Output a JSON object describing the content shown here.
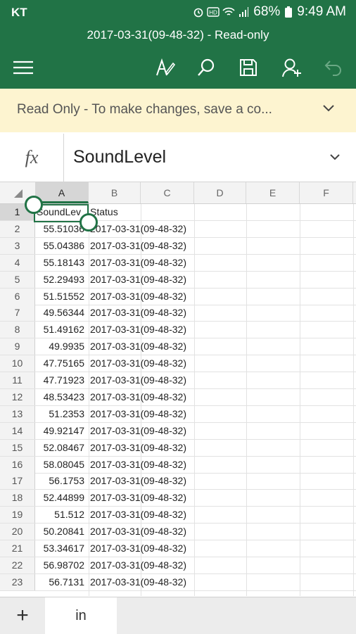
{
  "statusbar": {
    "carrier": "KT",
    "battery": "68%",
    "time": "9:49 AM"
  },
  "appbar": {
    "title": "2017-03-31(09-48-32) - Read-only",
    "icons": [
      "menu-icon",
      "draw-icon",
      "search-icon",
      "save-icon",
      "share-icon",
      "undo-icon"
    ]
  },
  "banner": {
    "message": "Read Only - To make changes, save a co..."
  },
  "formula": {
    "fx": "fx",
    "content": "SoundLevel"
  },
  "columns": [
    "A",
    "B",
    "C",
    "D",
    "E",
    "F"
  ],
  "rows": [
    {
      "n": "1",
      "a": "SoundLev",
      "b": "Status"
    },
    {
      "n": "2",
      "a": "55.51036",
      "b": "2017-03-31(09-48-32)"
    },
    {
      "n": "3",
      "a": "55.04386",
      "b": "2017-03-31(09-48-32)"
    },
    {
      "n": "4",
      "a": "55.18143",
      "b": "2017-03-31(09-48-32)"
    },
    {
      "n": "5",
      "a": "52.29493",
      "b": "2017-03-31(09-48-32)"
    },
    {
      "n": "6",
      "a": "51.51552",
      "b": "2017-03-31(09-48-32)"
    },
    {
      "n": "7",
      "a": "49.56344",
      "b": "2017-03-31(09-48-32)"
    },
    {
      "n": "8",
      "a": "51.49162",
      "b": "2017-03-31(09-48-32)"
    },
    {
      "n": "9",
      "a": "49.9935",
      "b": "2017-03-31(09-48-32)"
    },
    {
      "n": "10",
      "a": "47.75165",
      "b": "2017-03-31(09-48-32)"
    },
    {
      "n": "11",
      "a": "47.71923",
      "b": "2017-03-31(09-48-32)"
    },
    {
      "n": "12",
      "a": "48.53423",
      "b": "2017-03-31(09-48-32)"
    },
    {
      "n": "13",
      "a": "51.2353",
      "b": "2017-03-31(09-48-32)"
    },
    {
      "n": "14",
      "a": "49.92147",
      "b": "2017-03-31(09-48-32)"
    },
    {
      "n": "15",
      "a": "52.08467",
      "b": "2017-03-31(09-48-32)"
    },
    {
      "n": "16",
      "a": "58.08045",
      "b": "2017-03-31(09-48-32)"
    },
    {
      "n": "17",
      "a": "56.1753",
      "b": "2017-03-31(09-48-32)"
    },
    {
      "n": "18",
      "a": "52.44899",
      "b": "2017-03-31(09-48-32)"
    },
    {
      "n": "19",
      "a": "51.512",
      "b": "2017-03-31(09-48-32)"
    },
    {
      "n": "20",
      "a": "50.20841",
      "b": "2017-03-31(09-48-32)"
    },
    {
      "n": "21",
      "a": "53.34617",
      "b": "2017-03-31(09-48-32)"
    },
    {
      "n": "22",
      "a": "56.98702",
      "b": "2017-03-31(09-48-32)"
    },
    {
      "n": "23",
      "a": "56.7131",
      "b": "2017-03-31(09-48-32)"
    }
  ],
  "tabs": {
    "add_label": "+",
    "sheet_name": "in"
  },
  "colors": {
    "brand": "#217346",
    "banner": "#fdf4d0"
  }
}
